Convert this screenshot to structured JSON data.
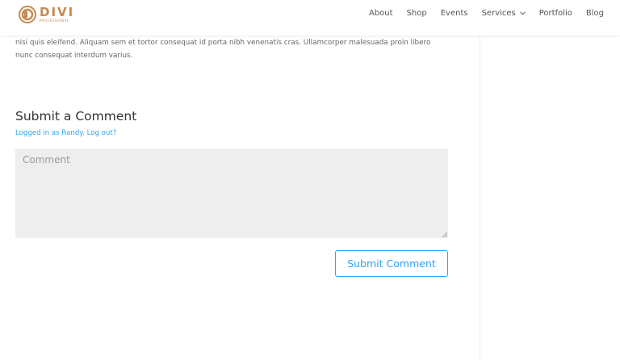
{
  "brand": {
    "name": "DIVI",
    "tagline": "PROFESSIONAL",
    "color": "#c38a52"
  },
  "nav": {
    "items": [
      {
        "label": "About"
      },
      {
        "label": "Shop"
      },
      {
        "label": "Events"
      },
      {
        "label": "Services",
        "icon": "chevron-down-icon"
      },
      {
        "label": "Portfolio"
      },
      {
        "label": "Blog"
      }
    ]
  },
  "post": {
    "text_line_1": "nisi quis eleifend. Aliquam sem et tortor consequat id porta nibh venenatis cras. Ullamcorper malesuada proin libero",
    "text_line_2": "nunc consequat interdum varius."
  },
  "comments": {
    "title": "Submit a Comment",
    "logged_in_prefix": "Logged in as Randy. ",
    "logout_label": "Log out?",
    "comment_placeholder": "Comment",
    "submit_label": "Submit Comment"
  },
  "colors": {
    "accent": "#2ea3f2",
    "field_bg": "#eeeeee"
  }
}
